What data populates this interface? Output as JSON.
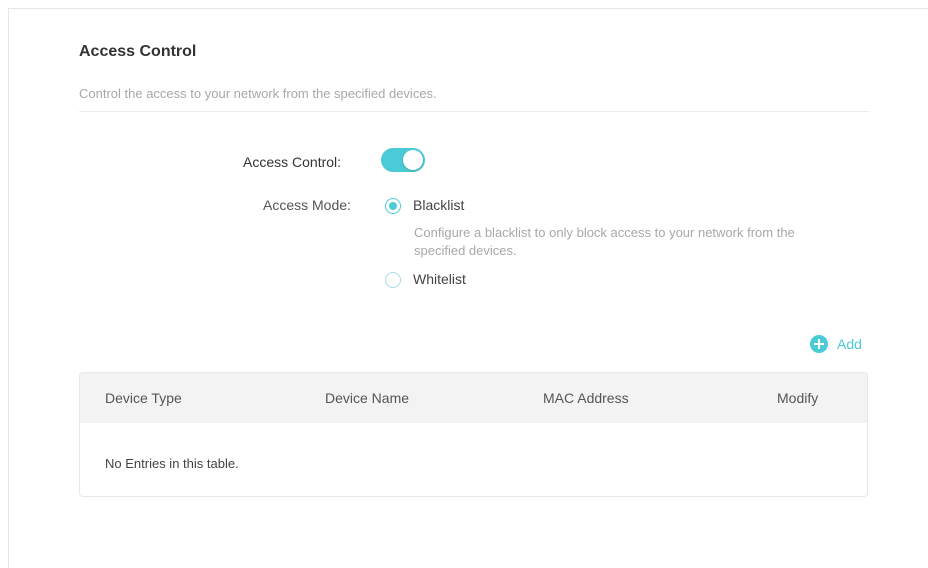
{
  "section": {
    "title": "Access Control",
    "description": "Control the access to your network from the specified devices."
  },
  "access_control": {
    "label": "Access Control:",
    "enabled": true
  },
  "access_mode": {
    "label": "Access Mode:",
    "selected": "Blacklist",
    "options": [
      {
        "label": "Blacklist",
        "checked": true,
        "hint": "Configure a blacklist to only block access to your network from the specified devices."
      },
      {
        "label": "Whitelist",
        "checked": false
      }
    ]
  },
  "add_button": {
    "label": "Add",
    "icon": "plus-circle-icon"
  },
  "table": {
    "columns": [
      "Device Type",
      "Device Name",
      "MAC Address",
      "Modify"
    ],
    "empty_message": "No Entries in this table."
  },
  "colors": {
    "accent": "#4acbd6",
    "header_bg": "#f3f3f3",
    "muted_text": "#a8a8a8"
  }
}
